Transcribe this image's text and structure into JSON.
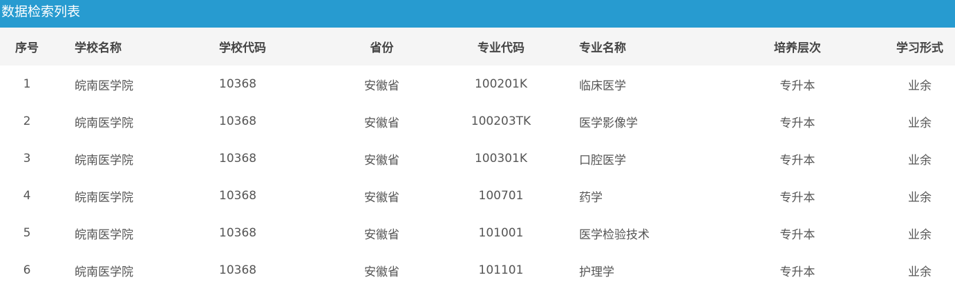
{
  "title": "数据检索列表",
  "columns": [
    "序号",
    "学校名称",
    "学校代码",
    "省份",
    "专业代码",
    "专业名称",
    "培养层次",
    "学习形式"
  ],
  "rows": [
    [
      "1",
      "皖南医学院",
      "10368",
      "安徽省",
      "100201K",
      "临床医学",
      "专升本",
      "业余"
    ],
    [
      "2",
      "皖南医学院",
      "10368",
      "安徽省",
      "100203TK",
      "医学影像学",
      "专升本",
      "业余"
    ],
    [
      "3",
      "皖南医学院",
      "10368",
      "安徽省",
      "100301K",
      "口腔医学",
      "专升本",
      "业余"
    ],
    [
      "4",
      "皖南医学院",
      "10368",
      "安徽省",
      "100701",
      "药学",
      "专升本",
      "业余"
    ],
    [
      "5",
      "皖南医学院",
      "10368",
      "安徽省",
      "101001",
      "医学检验技术",
      "专升本",
      "业余"
    ],
    [
      "6",
      "皖南医学院",
      "10368",
      "安徽省",
      "101101",
      "护理学",
      "专升本",
      "业余"
    ]
  ],
  "colors": {
    "title_bar": "#279bd0",
    "header_bg": "#f5f5f5"
  }
}
